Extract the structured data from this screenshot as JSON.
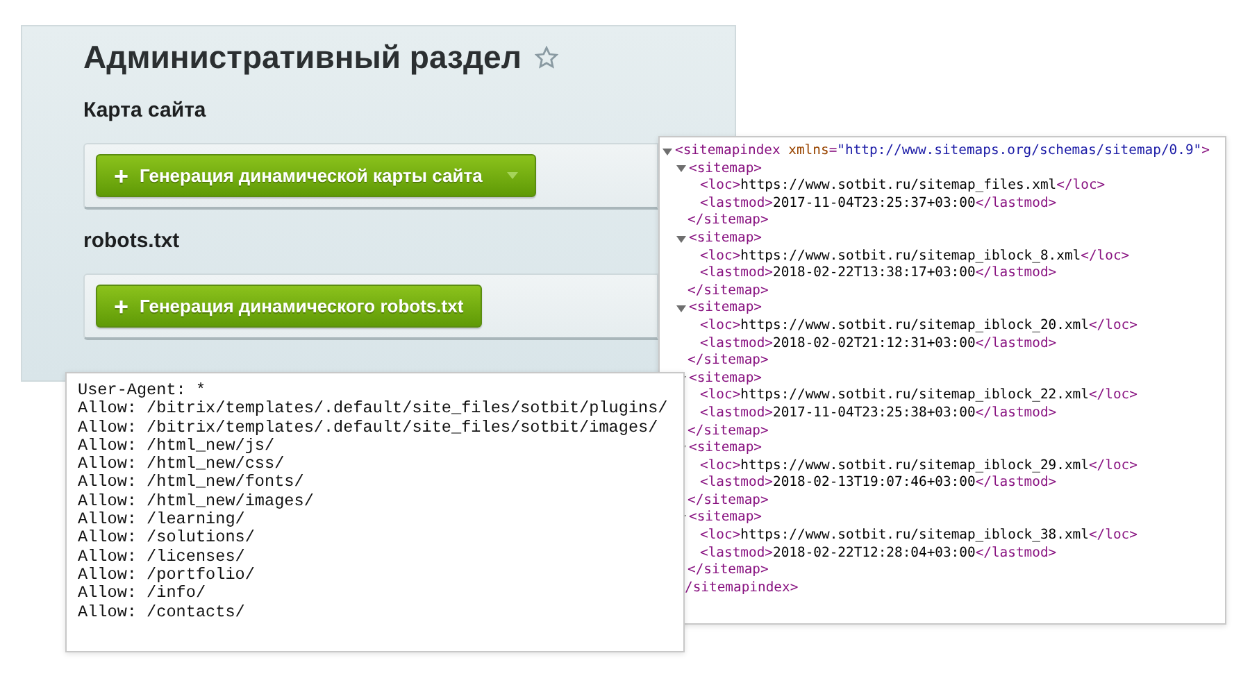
{
  "admin_panel": {
    "title": "Административный раздел",
    "sections": [
      {
        "heading": "Карта сайта",
        "button": {
          "label": "Генерация динамической карты сайта",
          "icon": "+",
          "has_dropdown": true
        }
      },
      {
        "heading": "robots.txt",
        "button": {
          "label": "Генерация динамического robots.txt",
          "icon": "+",
          "has_dropdown": false
        }
      }
    ]
  },
  "sitemap_xml": {
    "root_open": {
      "tag": "<sitemapindex",
      "attr": "xmlns",
      "eq": "=",
      "value": "\"http://www.sitemaps.org/schemas/sitemap/0.9\"",
      "end": ">"
    },
    "entries": [
      {
        "open": "<sitemap>",
        "loc_open": "<loc>",
        "loc": "https://www.sotbit.ru/sitemap_files.xml",
        "loc_close": "</loc>",
        "lastmod_open": "<lastmod>",
        "lastmod": "2017-11-04T23:25:37+03:00",
        "lastmod_close": "</lastmod>",
        "close": "</sitemap>",
        "expanded": true
      },
      {
        "open": "<sitemap>",
        "loc_open": "<loc>",
        "loc": "https://www.sotbit.ru/sitemap_iblock_8.xml",
        "loc_close": "</loc>",
        "lastmod_open": "<lastmod>",
        "lastmod": "2018-02-22T13:38:17+03:00",
        "lastmod_close": "</lastmod>",
        "close": "</sitemap>",
        "expanded": true
      },
      {
        "open": "<sitemap>",
        "loc_open": "<loc>",
        "loc": "https://www.sotbit.ru/sitemap_iblock_20.xml",
        "loc_close": "</loc>",
        "lastmod_open": "<lastmod>",
        "lastmod": "2018-02-02T21:12:31+03:00",
        "lastmod_close": "</lastmod>",
        "close": "</sitemap>",
        "expanded": true
      },
      {
        "open": "<sitemap>",
        "loc_open": "<loc>",
        "loc": "https://www.sotbit.ru/sitemap_iblock_22.xml",
        "loc_close": "</loc>",
        "lastmod_open": "<lastmod>",
        "lastmod": "2017-11-04T23:25:38+03:00",
        "lastmod_close": "</lastmod>",
        "close": "</sitemap>",
        "expanded": true
      },
      {
        "open": "<sitemap>",
        "loc_open": "<loc>",
        "loc": "https://www.sotbit.ru/sitemap_iblock_29.xml",
        "loc_close": "</loc>",
        "lastmod_open": "<lastmod>",
        "lastmod": "2018-02-13T19:07:46+03:00",
        "lastmod_close": "</lastmod>",
        "close": "</sitemap>",
        "expanded": true
      },
      {
        "open": "<sitemap>",
        "loc_open": "<loc>",
        "loc": "https://www.sotbit.ru/sitemap_iblock_38.xml",
        "loc_close": "</loc>",
        "lastmod_open": "<lastmod>",
        "lastmod": "2018-02-22T12:28:04+03:00",
        "lastmod_close": "</lastmod>",
        "close": "</sitemap>",
        "expanded": true
      }
    ],
    "root_close": "/sitemapindex>"
  },
  "robots_txt": {
    "lines": [
      "User-Agent: *",
      "Allow: /bitrix/templates/.default/site_files/sotbit/plugins/",
      "Allow: /bitrix/templates/.default/site_files/sotbit/images/",
      "Allow: /html_new/js/",
      "Allow: /html_new/css/",
      "Allow: /html_new/fonts/",
      "Allow: /html_new/images/",
      "Allow: /learning/",
      "Allow: /solutions/",
      "Allow: /licenses/",
      "Allow: /portfolio/",
      "Allow: /info/",
      "Allow: /contacts/"
    ]
  }
}
